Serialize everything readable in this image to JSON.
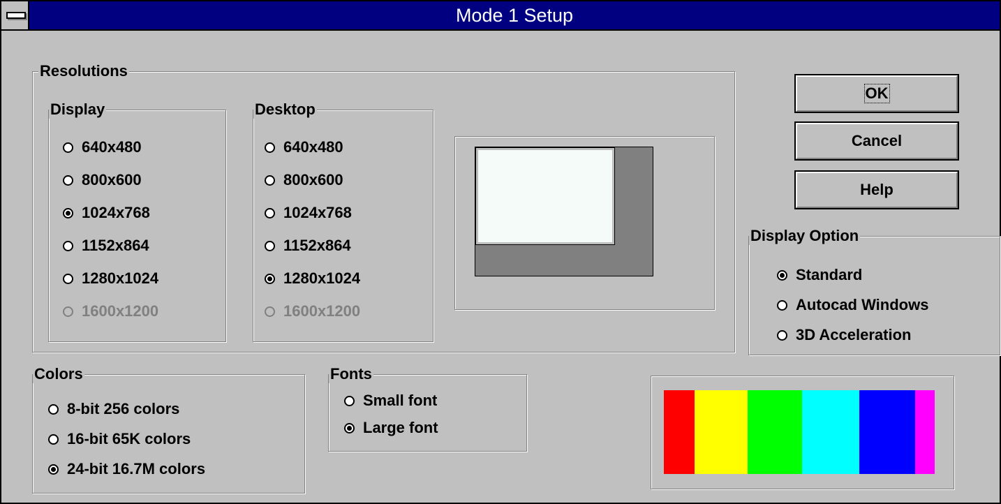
{
  "window": {
    "title": "Mode 1 Setup"
  },
  "resolutions": {
    "label": "Resolutions",
    "display": {
      "label": "Display",
      "options": [
        {
          "label": "640x480",
          "checked": false,
          "disabled": false
        },
        {
          "label": "800x600",
          "checked": false,
          "disabled": false
        },
        {
          "label": "1024x768",
          "checked": true,
          "disabled": false
        },
        {
          "label": "1152x864",
          "checked": false,
          "disabled": false
        },
        {
          "label": "1280x1024",
          "checked": false,
          "disabled": false
        },
        {
          "label": "1600x1200",
          "checked": false,
          "disabled": true
        }
      ]
    },
    "desktop": {
      "label": "Desktop",
      "options": [
        {
          "label": "640x480",
          "checked": false,
          "disabled": false
        },
        {
          "label": "800x600",
          "checked": false,
          "disabled": false
        },
        {
          "label": "1024x768",
          "checked": false,
          "disabled": false
        },
        {
          "label": "1152x864",
          "checked": false,
          "disabled": false
        },
        {
          "label": "1280x1024",
          "checked": true,
          "disabled": false
        },
        {
          "label": "1600x1200",
          "checked": false,
          "disabled": true
        }
      ]
    },
    "preview_colors": {
      "desktop": "#808080",
      "display": "#f4fbf8"
    }
  },
  "buttons": {
    "ok": "OK",
    "cancel": "Cancel",
    "help": "Help"
  },
  "display_option": {
    "label": "Display Option",
    "options": [
      {
        "label": "Standard",
        "checked": true
      },
      {
        "label": "Autocad Windows",
        "checked": false
      },
      {
        "label": "3D Acceleration",
        "checked": false
      }
    ]
  },
  "colors": {
    "label": "Colors",
    "options": [
      {
        "label": "8-bit 256 colors",
        "checked": false
      },
      {
        "label": "16-bit 65K colors",
        "checked": false
      },
      {
        "label": "24-bit 16.7M colors",
        "checked": true
      }
    ]
  },
  "fonts": {
    "label": "Fonts",
    "options": [
      {
        "label": "Small font",
        "checked": false
      },
      {
        "label": "Large font",
        "checked": true
      }
    ]
  },
  "color_bar": [
    "#ff0000",
    "#ffff00",
    "#00ff00",
    "#00ffff",
    "#0000ff",
    "#ff00ff"
  ]
}
